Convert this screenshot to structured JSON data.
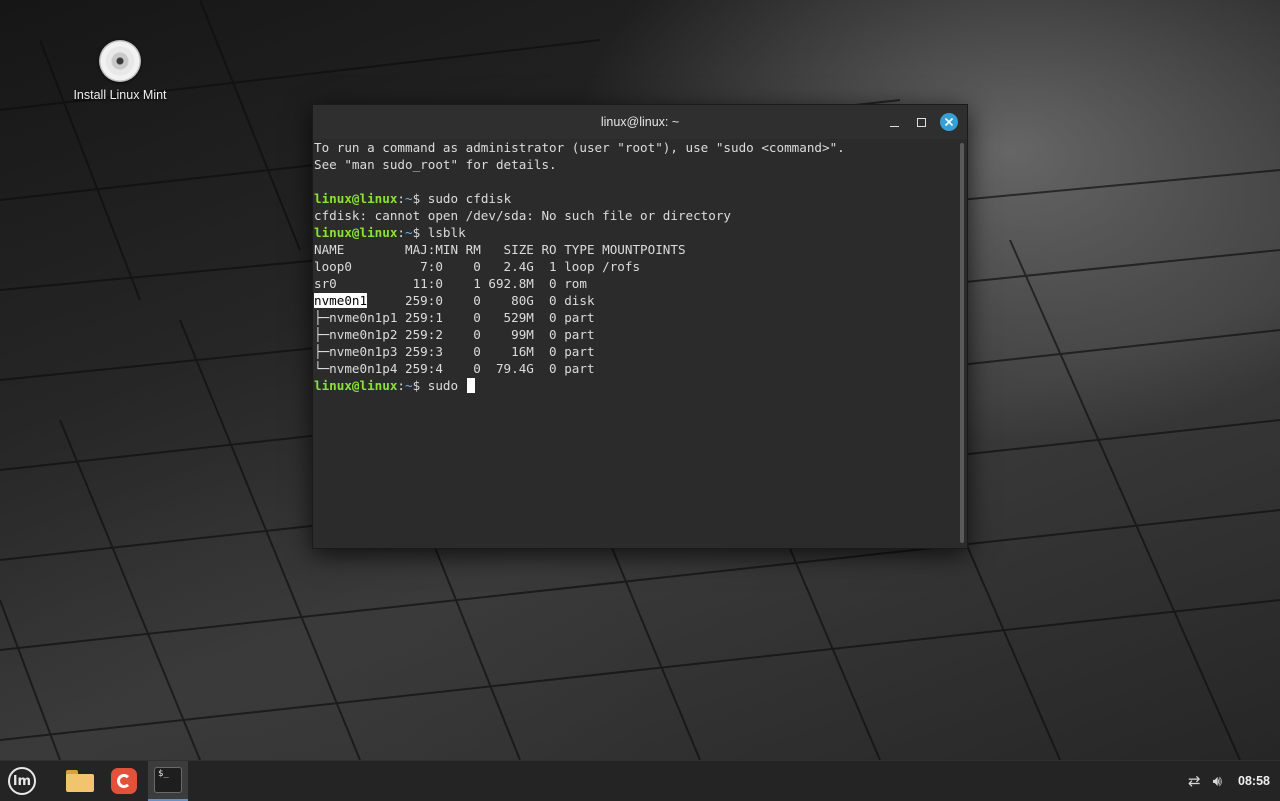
{
  "desktop": {
    "icons": [
      {
        "label": "Install Linux Mint",
        "icon": "disc-icon"
      }
    ]
  },
  "terminal": {
    "title": "linux@linux: ~",
    "controls": {
      "minimize": "minimize-icon",
      "maximize": "maximize-icon",
      "close": "close-icon"
    },
    "lines": [
      {
        "kind": "text",
        "text": "To run a command as administrator (user \"root\"), use \"sudo <command>\"."
      },
      {
        "kind": "text",
        "text": "See \"man sudo_root\" for details."
      },
      {
        "kind": "text",
        "text": ""
      },
      {
        "kind": "prompt",
        "user": "linux@linux",
        "sep": ":",
        "path": "~",
        "symbol": "$ ",
        "command": "sudo cfdisk"
      },
      {
        "kind": "text",
        "text": "cfdisk: cannot open /dev/sda: No such file or directory"
      },
      {
        "kind": "prompt",
        "user": "linux@linux",
        "sep": ":",
        "path": "~",
        "symbol": "$ ",
        "command": "lsblk"
      },
      {
        "kind": "text",
        "text": "NAME        MAJ:MIN RM   SIZE RO TYPE MOUNTPOINTS"
      },
      {
        "kind": "text",
        "text": "loop0         7:0    0   2.4G  1 loop /rofs"
      },
      {
        "kind": "text",
        "text": "sr0          11:0    1 692.8M  0 rom"
      },
      {
        "kind": "selected",
        "selected": "nvme0n1",
        "text": "     259:0    0    80G  0 disk"
      },
      {
        "kind": "text",
        "text": "├─nvme0n1p1 259:1    0   529M  0 part"
      },
      {
        "kind": "text",
        "text": "├─nvme0n1p2 259:2    0    99M  0 part"
      },
      {
        "kind": "text",
        "text": "├─nvme0n1p3 259:3    0    16M  0 part"
      },
      {
        "kind": "text",
        "text": "└─nvme0n1p4 259:4    0  79.4G  0 part"
      },
      {
        "kind": "prompt",
        "user": "linux@linux",
        "sep": ":",
        "path": "~",
        "symbol": "$ ",
        "command": "sudo ",
        "cursor": true
      }
    ]
  },
  "taskbar": {
    "items": [
      {
        "name": "menu-button",
        "icon": "linux-mint-logo-icon",
        "glyph": "lm"
      },
      {
        "name": "files-launcher",
        "icon": "folder-icon"
      },
      {
        "name": "firefox-launcher",
        "icon": "firefox-icon"
      },
      {
        "name": "terminal-launcher",
        "icon": "terminal-icon",
        "glyph": "$_"
      }
    ],
    "tray": {
      "network_icon": "network-icon",
      "volume_icon": "volume-icon",
      "clock": "08:58"
    }
  }
}
